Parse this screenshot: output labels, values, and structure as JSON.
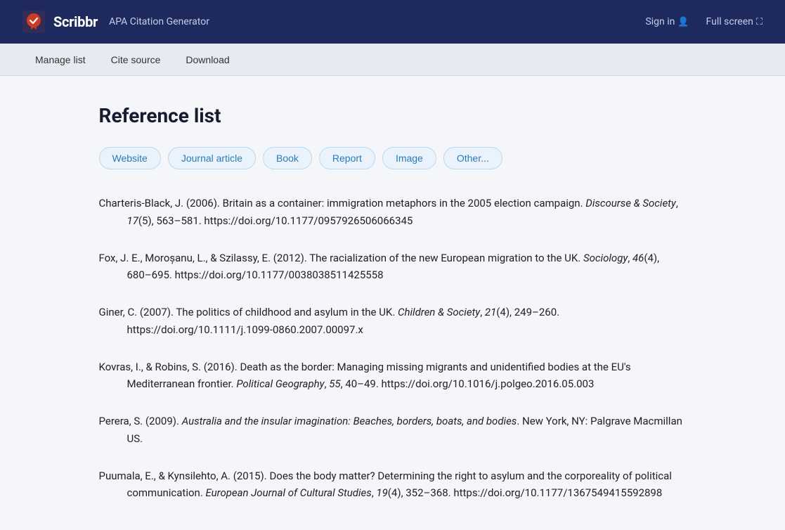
{
  "header": {
    "brand": "Scribbr",
    "subtitle": "APA Citation Generator",
    "sign_in": "Sign in",
    "full_screen": "Full screen"
  },
  "toolbar": {
    "manage_list": "Manage list",
    "cite_source": "Cite source",
    "download": "Download"
  },
  "main": {
    "page_title": "Reference list",
    "source_types": [
      "Website",
      "Journal article",
      "Book",
      "Report",
      "Image",
      "Other..."
    ],
    "references": [
      {
        "id": "charteris",
        "text_before_italic": "Charteris-Black, J. (2006). Britain as a container: immigration metaphors in the 2005 election campaign.",
        "italic": "Discourse & Society",
        "text_after_italic": ", 17(5), 563–581. https://doi.org/10.1177/0957926506066345"
      },
      {
        "id": "fox",
        "text_before_italic": "Fox, J. E., Moroșanu, L., & Szilassy, E. (2012). The racialization of the new European migration to the UK.",
        "italic": "Sociology",
        "text_after_italic": ", 46(4), 680–695. https://doi.org/10.1177/0038038511425558"
      },
      {
        "id": "giner",
        "text_before_italic": "Giner, C. (2007). The politics of childhood and asylum in the UK.",
        "italic": "Children & Society",
        "text_after_italic": ", 21(4), 249–260. https://doi.org/10.1111/j.1099-0860.2007.00097.x"
      },
      {
        "id": "kovras",
        "text_before_italic": "Kovras, I., & Robins, S. (2016). Death as the border: Managing missing migrants and unidentified bodies at the EU's Mediterranean frontier.",
        "italic": "Political Geography",
        "text_after_italic": ", 55, 40–49. https://doi.org/10.1016/j.polgeo.2016.05.003"
      },
      {
        "id": "perera",
        "text_before_italic": "Perera, S. (2009).",
        "italic": "Australia and the insular imagination: Beaches, borders, boats, and bodies",
        "text_after_italic": ". New York, NY: Palgrave Macmillan US."
      },
      {
        "id": "puumala",
        "text_before_italic": "Puumala, E., & Kynsilehto, A. (2015). Does the body matter? Determining the right to asylum and the corporeality of political communication.",
        "italic": "European Journal of Cultural Studies",
        "text_after_italic": ", 19(4), 352–368. https://doi.org/10.1177/1367549415592898"
      }
    ]
  }
}
